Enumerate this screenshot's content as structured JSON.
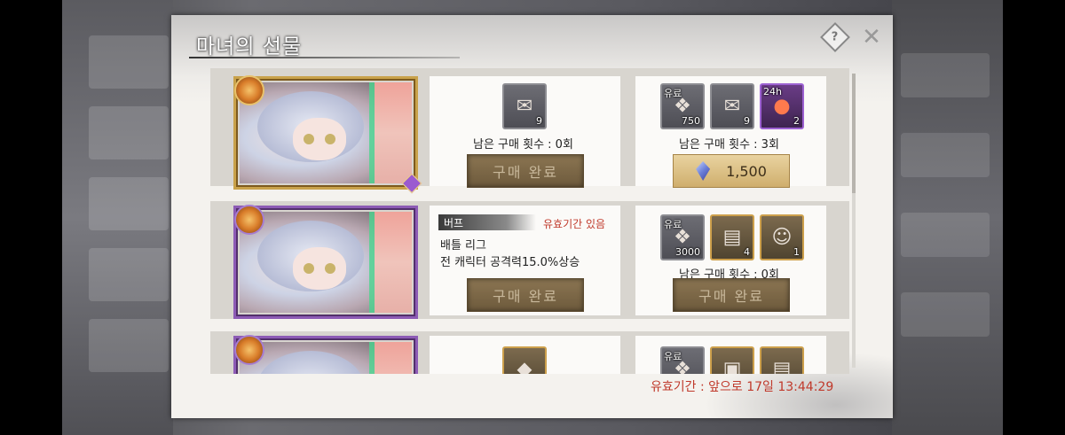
{
  "window": {
    "title": "마녀의 선물",
    "help_glyph": "?",
    "close_glyph": "✕",
    "expiry": "유효기간 : 앞으로 17일 13:44:29"
  },
  "rows": [
    {
      "portrait_frame": "gold",
      "left_card": {
        "items": [
          {
            "icon": "mail-icon",
            "count": "9",
            "frame": "silver"
          }
        ],
        "remaining": "남은 구매 횟수 : 0회",
        "button": "구매 완료"
      },
      "right_card": {
        "items": [
          {
            "icon": "crystal-icon",
            "tag": "유료",
            "count": "750",
            "frame": "silver"
          },
          {
            "icon": "mail-icon",
            "count": "9",
            "frame": "silver"
          },
          {
            "icon": "orb-icon",
            "tag": "24h",
            "count": "2",
            "frame": "purple"
          }
        ],
        "remaining": "남은 구매 횟수 : 3회",
        "price": "1,500"
      }
    },
    {
      "portrait_frame": "purple",
      "left_card": {
        "buff_label": "버프",
        "valid_label": "유효기간 있음",
        "desc_line1": "배틀 리그",
        "desc_line2": "전 캐릭터 공격력15.0%상승",
        "button": "구매 완료"
      },
      "right_card": {
        "items": [
          {
            "icon": "crystal-icon",
            "tag": "유료",
            "count": "3000",
            "frame": "silver"
          },
          {
            "icon": "book-icon",
            "count": "4",
            "frame": "gold"
          },
          {
            "icon": "portrait-icon",
            "count": "1",
            "frame": "gold"
          }
        ],
        "remaining": "남은 구매 횟수 : 0회",
        "button": "구매 완료"
      }
    },
    {
      "portrait_frame": "purple",
      "left_card": {
        "items": [
          {
            "icon": "stone-icon",
            "frame": "gold"
          }
        ]
      },
      "right_card": {
        "items": [
          {
            "icon": "crystal-icon",
            "tag": "유료",
            "frame": "silver"
          },
          {
            "icon": "chest-icon",
            "frame": "gold"
          },
          {
            "icon": "book-icon",
            "frame": "gold"
          }
        ]
      }
    }
  ],
  "scroll_position": 0
}
